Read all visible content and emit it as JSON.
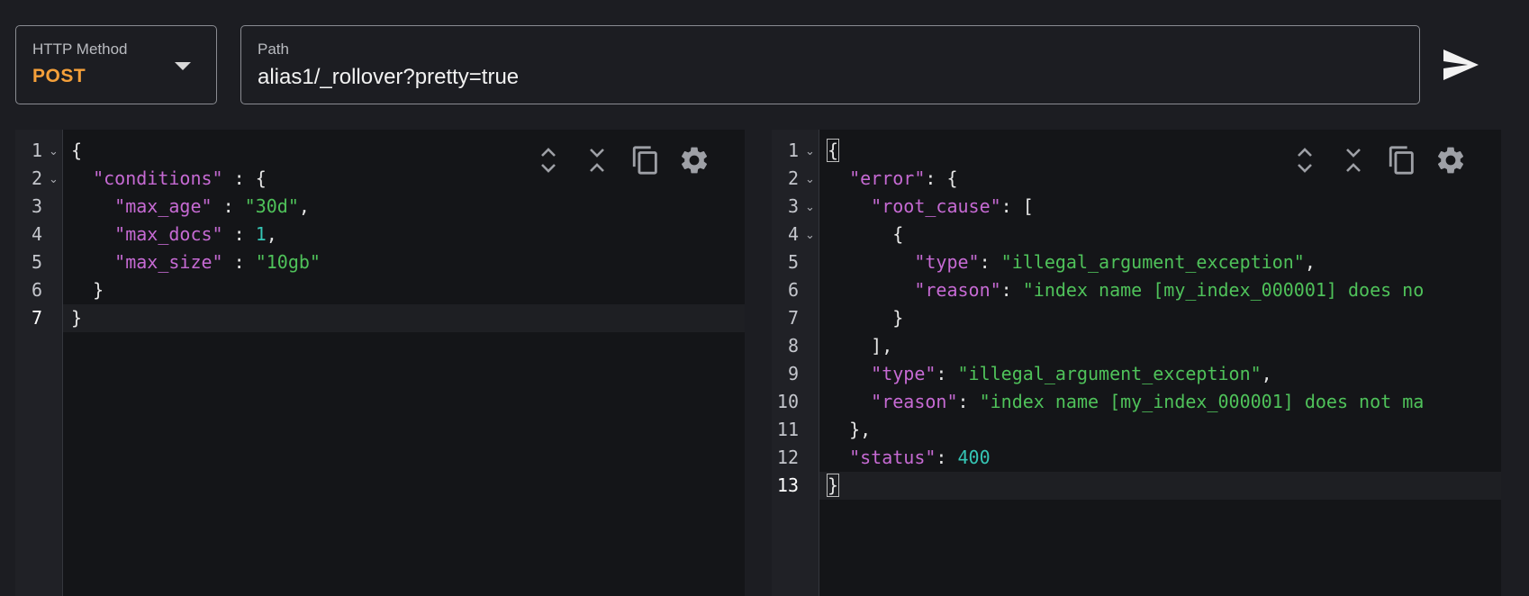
{
  "request": {
    "method_label": "HTTP Method",
    "method_value": "POST",
    "path_label": "Path",
    "path_value": "alias1/_rollover?pretty=true"
  },
  "icons": {
    "send": "send-icon",
    "expand": "expand-all-icon",
    "collapse": "collapse-all-icon",
    "copy": "copy-icon",
    "settings": "gear-icon"
  },
  "colors": {
    "method": "#f5a03a",
    "key": "#c66ad3",
    "string": "#4fc25a",
    "number": "#35c6b5"
  },
  "request_editor": {
    "line_numbers": [
      "1",
      "2",
      "3",
      "4",
      "5",
      "6",
      "7"
    ],
    "lines": [
      {
        "tokens": [
          {
            "t": "p",
            "v": "{"
          }
        ]
      },
      {
        "tokens": [
          {
            "t": "p",
            "v": "  "
          },
          {
            "t": "k",
            "v": "\"conditions\""
          },
          {
            "t": "p",
            "v": " : {"
          }
        ]
      },
      {
        "tokens": [
          {
            "t": "p",
            "v": "    "
          },
          {
            "t": "k",
            "v": "\"max_age\""
          },
          {
            "t": "p",
            "v": " : "
          },
          {
            "t": "s",
            "v": "\"30d\""
          },
          {
            "t": "p",
            "v": ","
          }
        ]
      },
      {
        "tokens": [
          {
            "t": "p",
            "v": "    "
          },
          {
            "t": "k",
            "v": "\"max_docs\""
          },
          {
            "t": "p",
            "v": " : "
          },
          {
            "t": "n",
            "v": "1"
          },
          {
            "t": "p",
            "v": ","
          }
        ]
      },
      {
        "tokens": [
          {
            "t": "p",
            "v": "    "
          },
          {
            "t": "k",
            "v": "\"max_size\""
          },
          {
            "t": "p",
            "v": " : "
          },
          {
            "t": "s",
            "v": "\"10gb\""
          }
        ]
      },
      {
        "tokens": [
          {
            "t": "p",
            "v": "  }"
          }
        ]
      },
      {
        "tokens": [
          {
            "t": "p",
            "v": "}"
          }
        ]
      }
    ]
  },
  "response_editor": {
    "line_numbers": [
      "1",
      "2",
      "3",
      "4",
      "5",
      "6",
      "7",
      "8",
      "9",
      "10",
      "11",
      "12",
      "13"
    ],
    "lines": [
      {
        "tokens": [
          {
            "t": "p",
            "v": "{"
          }
        ]
      },
      {
        "tokens": [
          {
            "t": "p",
            "v": "  "
          },
          {
            "t": "k",
            "v": "\"error\""
          },
          {
            "t": "p",
            "v": ": {"
          }
        ]
      },
      {
        "tokens": [
          {
            "t": "p",
            "v": "    "
          },
          {
            "t": "k",
            "v": "\"root_cause\""
          },
          {
            "t": "p",
            "v": ": ["
          }
        ]
      },
      {
        "tokens": [
          {
            "t": "p",
            "v": "      {"
          }
        ]
      },
      {
        "tokens": [
          {
            "t": "p",
            "v": "        "
          },
          {
            "t": "k",
            "v": "\"type\""
          },
          {
            "t": "p",
            "v": ": "
          },
          {
            "t": "s",
            "v": "\"illegal_argument_exception\""
          },
          {
            "t": "p",
            "v": ","
          }
        ]
      },
      {
        "tokens": [
          {
            "t": "p",
            "v": "        "
          },
          {
            "t": "k",
            "v": "\"reason\""
          },
          {
            "t": "p",
            "v": ": "
          },
          {
            "t": "s",
            "v": "\"index name [my_index_000001] does no"
          }
        ]
      },
      {
        "tokens": [
          {
            "t": "p",
            "v": "      }"
          }
        ]
      },
      {
        "tokens": [
          {
            "t": "p",
            "v": "    ],"
          }
        ]
      },
      {
        "tokens": [
          {
            "t": "p",
            "v": "    "
          },
          {
            "t": "k",
            "v": "\"type\""
          },
          {
            "t": "p",
            "v": ": "
          },
          {
            "t": "s",
            "v": "\"illegal_argument_exception\""
          },
          {
            "t": "p",
            "v": ","
          }
        ]
      },
      {
        "tokens": [
          {
            "t": "p",
            "v": "    "
          },
          {
            "t": "k",
            "v": "\"reason\""
          },
          {
            "t": "p",
            "v": ": "
          },
          {
            "t": "s",
            "v": "\"index name [my_index_000001] does not ma"
          }
        ]
      },
      {
        "tokens": [
          {
            "t": "p",
            "v": "  },"
          }
        ]
      },
      {
        "tokens": [
          {
            "t": "p",
            "v": "  "
          },
          {
            "t": "k",
            "v": "\"status\""
          },
          {
            "t": "p",
            "v": ": "
          },
          {
            "t": "n",
            "v": "400"
          }
        ]
      },
      {
        "tokens": [
          {
            "t": "p",
            "v": "}"
          }
        ]
      }
    ]
  }
}
